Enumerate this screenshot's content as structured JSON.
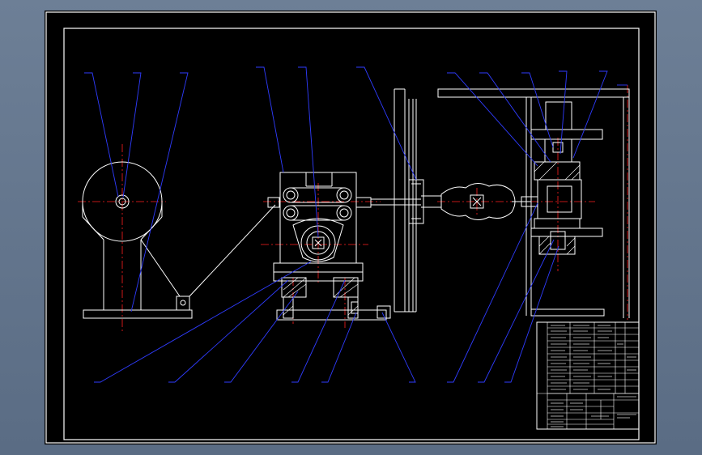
{
  "drawing": {
    "background": "#000000",
    "frame_color": "#ffffff",
    "leader_color": "#2f3cff",
    "centerline_color": "#ff2020",
    "view": "front-elevation"
  },
  "title_block": {
    "name": "",
    "company": "",
    "scale": "",
    "drawing_no": ""
  }
}
